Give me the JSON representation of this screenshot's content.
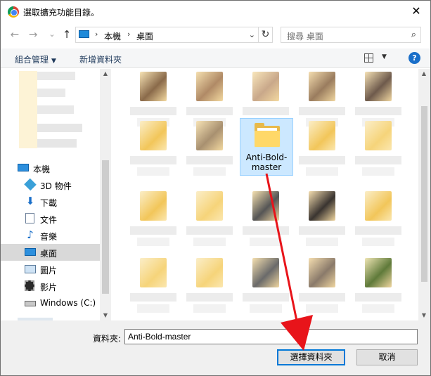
{
  "window": {
    "title": "選取擴充功能目錄。",
    "close_glyph": "✕"
  },
  "nav": {
    "back_glyph": "←",
    "forward_glyph": "→",
    "recent_glyph": "⌄",
    "up_glyph": "↑",
    "breadcrumb": [
      "本機",
      "桌面"
    ],
    "refresh_glyph": "↻",
    "search_placeholder": "搜尋 桌面"
  },
  "commands": {
    "organize": "組合管理",
    "new_folder": "新增資料夾",
    "help": "?"
  },
  "sidebar": {
    "items": [
      {
        "label": "本機",
        "icon": "computer-icon"
      },
      {
        "label": "3D 物件",
        "icon": "3d-objects-icon"
      },
      {
        "label": "下載",
        "icon": "download-icon"
      },
      {
        "label": "文件",
        "icon": "document-icon"
      },
      {
        "label": "音樂",
        "icon": "music-icon"
      },
      {
        "label": "桌面",
        "icon": "desktop-icon",
        "selected": true
      },
      {
        "label": "圖片",
        "icon": "pictures-icon"
      },
      {
        "label": "影片",
        "icon": "videos-icon"
      },
      {
        "label": "Windows (C:)",
        "icon": "drive-icon"
      }
    ]
  },
  "content": {
    "selected_folder": "Anti-Bold-master"
  },
  "footer": {
    "folder_label": "資料夾:",
    "folder_value": "Anti-Bold-master",
    "select_button": "選擇資料夾",
    "cancel_button": "取消"
  },
  "colors": {
    "arrow": "#e8141a",
    "selection": "#cce8ff",
    "accent": "#0078d7"
  }
}
